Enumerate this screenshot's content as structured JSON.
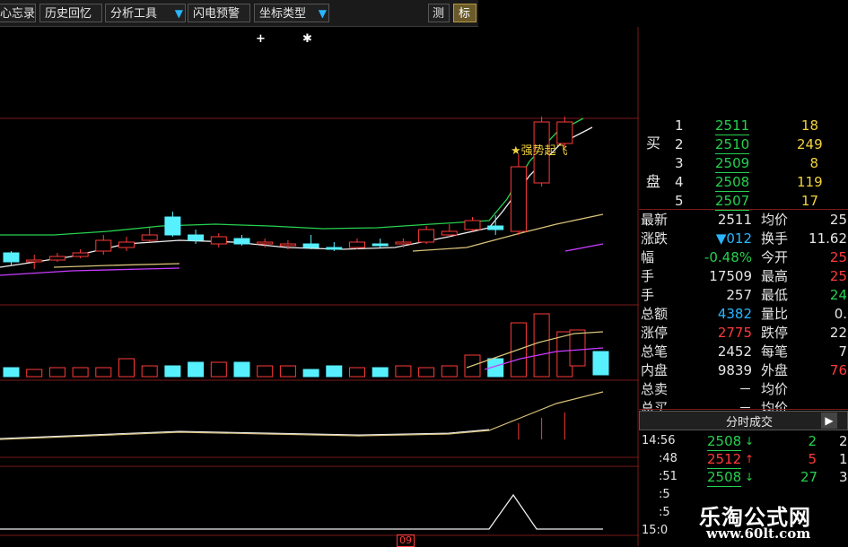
{
  "toolbar": {
    "memo": "心忘录",
    "history": "历史回忆",
    "analysis": "分析工具",
    "flash": "闪电预警",
    "coord": "坐标类型",
    "measure": "测",
    "mark": "标"
  },
  "marks": {
    "plus": "+",
    "star": "✱"
  },
  "signal_label": "★强势起飞",
  "buy_book": {
    "side_label_1": "买",
    "side_label_2": "盘",
    "rows": [
      {
        "level": "1",
        "price": "2511",
        "vol": "18"
      },
      {
        "level": "2",
        "price": "2510",
        "vol": "249"
      },
      {
        "level": "3",
        "price": "2509",
        "vol": "8"
      },
      {
        "level": "4",
        "price": "2508",
        "vol": "119"
      },
      {
        "level": "5",
        "price": "2507",
        "vol": "17"
      }
    ]
  },
  "quote": [
    {
      "label": "最新",
      "value": "2511",
      "label2": "均价",
      "value2": "25"
    },
    {
      "label": "涨跌",
      "value": "▼012",
      "label2": "换手",
      "value2": "11.62"
    },
    {
      "label": "幅",
      "value": "-0.48%",
      "label2": "今开",
      "value2": "25"
    },
    {
      "label": "手",
      "value": "17509",
      "label2": "最高",
      "value2": "25"
    },
    {
      "label": "手",
      "value": "257",
      "label2": "最低",
      "value2": "24"
    },
    {
      "label": "总额",
      "value": "4382",
      "label2": "量比",
      "value2": "0."
    },
    {
      "label": "涨停",
      "value": "2775",
      "label2": "跌停",
      "value2": "22"
    },
    {
      "label": "总笔",
      "value": "2452",
      "label2": "每笔",
      "value2": "7"
    },
    {
      "label": "内盘",
      "value": "9839",
      "label2": "外盘",
      "value2": "76"
    },
    {
      "label": "总卖",
      "value": "－",
      "label2": "均价",
      "value2": ""
    },
    {
      "label": "总买",
      "value": "－",
      "label2": "均价",
      "value2": ""
    }
  ],
  "tick_tab": {
    "title": "分时成交",
    "play": "▶"
  },
  "ticks": [
    {
      "time": "14:56",
      "price": "2508",
      "dir": "down",
      "vol": "2",
      "extra": "2"
    },
    {
      "time": ":48",
      "price": "2512",
      "dir": "up",
      "vol": "5",
      "extra": "1"
    },
    {
      "time": ":51",
      "price": "2508",
      "dir": "down",
      "vol": "27",
      "extra": "3"
    },
    {
      "time": ":5",
      "price": "",
      "dir": "",
      "vol": "",
      "extra": ""
    },
    {
      "time": ":5",
      "price": "",
      "dir": "",
      "vol": "",
      "extra": ""
    },
    {
      "time": "15:0",
      "price": "",
      "dir": "",
      "vol": "",
      "extra": ""
    }
  ],
  "watermark": {
    "name": "乐淘公式网",
    "url": "www.60lt.com"
  },
  "date_marker": "09",
  "colors": {
    "up": "#ff3a3a",
    "down": "#56f0ff",
    "ma_white": "#f0f0f0",
    "ma_yellow": "#d9c27a",
    "ma_purple": "#c83cff",
    "ma_green": "#26d14f",
    "grid": "#7a1a1a"
  },
  "chart_data": {
    "type": "candlestick",
    "candles": [
      {
        "o": 292,
        "c": 282,
        "h": 280,
        "l": 296,
        "up": false
      },
      {
        "o": 290,
        "c": 290,
        "h": 284,
        "l": 300,
        "up": true
      },
      {
        "o": 290,
        "c": 286,
        "h": 282,
        "l": 292,
        "up": true
      },
      {
        "o": 286,
        "c": 282,
        "h": 278,
        "l": 288,
        "up": true
      },
      {
        "o": 280,
        "c": 268,
        "h": 262,
        "l": 284,
        "up": true
      },
      {
        "o": 276,
        "c": 270,
        "h": 264,
        "l": 280,
        "up": true
      },
      {
        "o": 268,
        "c": 262,
        "h": 254,
        "l": 270,
        "up": true
      },
      {
        "o": 262,
        "c": 242,
        "h": 236,
        "l": 264,
        "up": false
      },
      {
        "o": 262,
        "c": 268,
        "h": 256,
        "l": 272,
        "up": false
      },
      {
        "o": 272,
        "c": 264,
        "h": 260,
        "l": 276,
        "up": true
      },
      {
        "o": 266,
        "c": 272,
        "h": 262,
        "l": 274,
        "up": false
      },
      {
        "o": 270,
        "c": 272,
        "h": 266,
        "l": 276,
        "up": true
      },
      {
        "o": 272,
        "c": 274,
        "h": 268,
        "l": 278,
        "up": true
      },
      {
        "o": 272,
        "c": 276,
        "h": 262,
        "l": 278,
        "up": false
      },
      {
        "o": 276,
        "c": 276,
        "h": 270,
        "l": 280,
        "up": false
      },
      {
        "o": 276,
        "c": 270,
        "h": 266,
        "l": 278,
        "up": true
      },
      {
        "o": 272,
        "c": 272,
        "h": 266,
        "l": 276,
        "up": false
      },
      {
        "o": 272,
        "c": 270,
        "h": 266,
        "l": 276,
        "up": true
      },
      {
        "o": 270,
        "c": 256,
        "h": 252,
        "l": 272,
        "up": true
      },
      {
        "o": 262,
        "c": 258,
        "h": 250,
        "l": 264,
        "up": true
      },
      {
        "o": 256,
        "c": 246,
        "h": 242,
        "l": 258,
        "up": true
      },
      {
        "o": 256,
        "c": 252,
        "h": 240,
        "l": 262,
        "up": false
      },
      {
        "o": 258,
        "c": 186,
        "h": 172,
        "l": 262,
        "up": true
      },
      {
        "o": 204,
        "c": 136,
        "h": 130,
        "l": 208,
        "up": true
      },
      {
        "o": 160,
        "c": 136,
        "h": 130,
        "l": 164,
        "up": true
      }
    ]
  }
}
